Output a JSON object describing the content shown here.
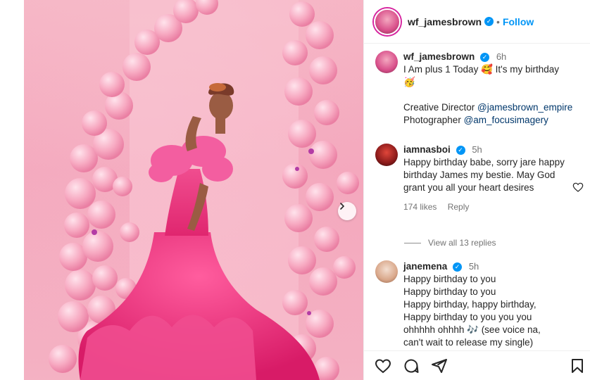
{
  "post": {
    "username": "wf_jamesbrown",
    "follow_label": "Follow",
    "separator": "•"
  },
  "caption": {
    "username": "wf_jamesbrown",
    "time": "6h",
    "line1": "I Am plus 1 Today",
    "emoji1": "🥰",
    "line1b": "It's my birthday",
    "emoji2": "🥳",
    "credit1_label": "Creative Director",
    "credit1_mention": "@jamesbrown_empire",
    "credit2_label": "Photographer",
    "credit2_mention": "@am_focusimagery"
  },
  "comments": [
    {
      "username": "iamnasboi",
      "time": "5h",
      "text": "Happy birthday babe, sorry jare happy birthday James my bestie. May God grant you all your heart desires",
      "likes": "174 likes",
      "reply_label": "Reply",
      "view_replies": "View all 13 replies"
    },
    {
      "username": "janemena",
      "time": "5h",
      "lines": [
        "Happy birthday to you",
        "Happy birthday to you",
        "Happy birthday, happy birthday,",
        "Happy birthday to you you you"
      ],
      "last_a": "ohhhhh ohhhh",
      "last_emoji": "🎶",
      "last_b": "(see voice na,",
      "last_c": "can't wait to release my single)"
    }
  ],
  "icons": {
    "like": "heart-icon",
    "comment": "comment-icon",
    "share": "share-icon",
    "save": "bookmark-icon",
    "next": "chevron-right-icon",
    "verified": "verified-badge-icon"
  },
  "colors": {
    "accent": "#0095f6",
    "mention": "#00376b",
    "muted": "#737373",
    "backdrop_pink": "#f4a8bd",
    "dress_pink": "#e8317a"
  }
}
